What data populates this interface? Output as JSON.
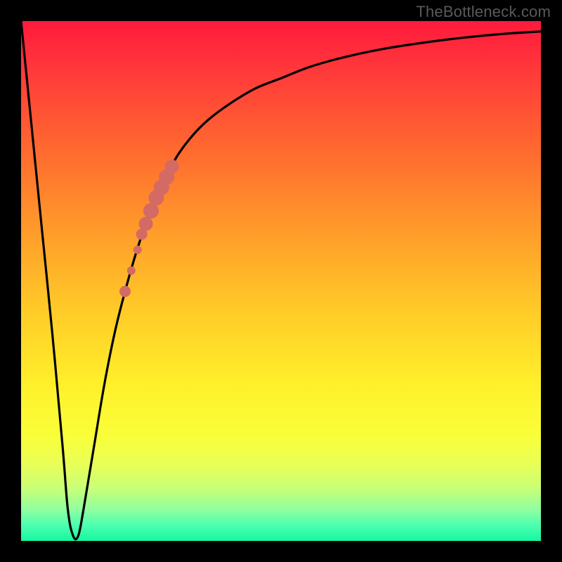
{
  "watermark": "TheBottleneck.com",
  "colors": {
    "background": "#000000",
    "curve_stroke": "#000000",
    "marker_fill": "#d46a64",
    "gradient_stops": [
      "#ff1a3c",
      "#ff3a3a",
      "#ff6a2f",
      "#ff9a2a",
      "#ffc928",
      "#fff02a",
      "#f9ff3a",
      "#eaff55",
      "#c8ff78",
      "#8fffa0",
      "#4cffb0",
      "#14f7a0"
    ]
  },
  "chart_data": {
    "type": "line",
    "title": "",
    "xlabel": "",
    "ylabel": "",
    "xlim": [
      0,
      100
    ],
    "ylim": [
      0,
      100
    ],
    "grid": false,
    "legend": false,
    "series": [
      {
        "name": "bottleneck-curve",
        "x": [
          0,
          2,
          4,
          6,
          8,
          9,
          10,
          11,
          12,
          14,
          16,
          18,
          20,
          22,
          24,
          26,
          28,
          30,
          33,
          36,
          40,
          45,
          50,
          55,
          60,
          65,
          70,
          75,
          80,
          85,
          90,
          95,
          100
        ],
        "y": [
          100,
          80,
          60,
          40,
          18,
          6,
          1,
          1,
          6,
          18,
          30,
          40,
          48,
          55,
          61,
          66,
          70,
          74,
          78,
          81,
          84,
          87,
          89,
          91,
          92.5,
          93.7,
          94.7,
          95.5,
          96.2,
          96.8,
          97.3,
          97.7,
          98
        ]
      }
    ],
    "markers": {
      "name": "highlight-dots",
      "x": [
        20.0,
        21.2,
        22.4,
        23.2,
        24.0,
        25.0,
        26.0,
        27.0,
        28.0,
        29.0
      ],
      "y": [
        48.0,
        52.0,
        56.0,
        59.0,
        61.0,
        63.5,
        66.0,
        68.0,
        70.0,
        72.0
      ],
      "sizes": [
        8,
        6,
        6,
        8,
        10,
        11,
        11,
        11,
        11,
        10
      ]
    }
  }
}
